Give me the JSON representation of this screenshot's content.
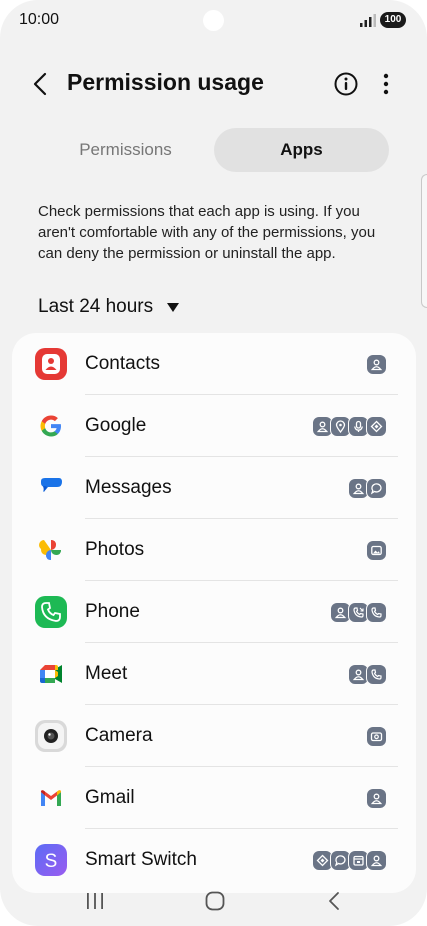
{
  "status_bar": {
    "time": "10:00",
    "battery": "100"
  },
  "header": {
    "title": "Permission usage"
  },
  "tabs": [
    {
      "label": "Permissions",
      "selected": false
    },
    {
      "label": "Apps",
      "selected": true
    }
  ],
  "description": "Check permissions that each app is using. If you aren't comfortable with any of the permissions, you can deny the permission or uninstall the app.",
  "filter": {
    "label": "Last 24 hours"
  },
  "apps": [
    {
      "name": "Contacts",
      "icon": "contacts-app-icon",
      "permissions": [
        "contacts"
      ]
    },
    {
      "name": "Google",
      "icon": "google-app-icon",
      "permissions": [
        "contacts",
        "location",
        "microphone",
        "nearby-devices"
      ]
    },
    {
      "name": "Messages",
      "icon": "messages-app-icon",
      "permissions": [
        "contacts",
        "sms"
      ]
    },
    {
      "name": "Photos",
      "icon": "photos-app-icon",
      "permissions": [
        "photos-videos"
      ]
    },
    {
      "name": "Phone",
      "icon": "phone-app-icon",
      "permissions": [
        "contacts",
        "call-logs",
        "phone"
      ]
    },
    {
      "name": "Meet",
      "icon": "meet-app-icon",
      "permissions": [
        "contacts",
        "phone"
      ]
    },
    {
      "name": "Camera",
      "icon": "camera-app-icon",
      "permissions": [
        "camera"
      ]
    },
    {
      "name": "Gmail",
      "icon": "gmail-app-icon",
      "permissions": [
        "contacts"
      ]
    },
    {
      "name": "Smart Switch",
      "icon": "smart-switch-app-icon",
      "permissions": [
        "nearby-devices",
        "sms",
        "calendar",
        "contacts"
      ]
    }
  ],
  "colors": {
    "background": "#f2f2f2",
    "card": "#fcfcfc",
    "permission_badge": "#6a7486",
    "selected_tab": "#e1e1e1"
  }
}
